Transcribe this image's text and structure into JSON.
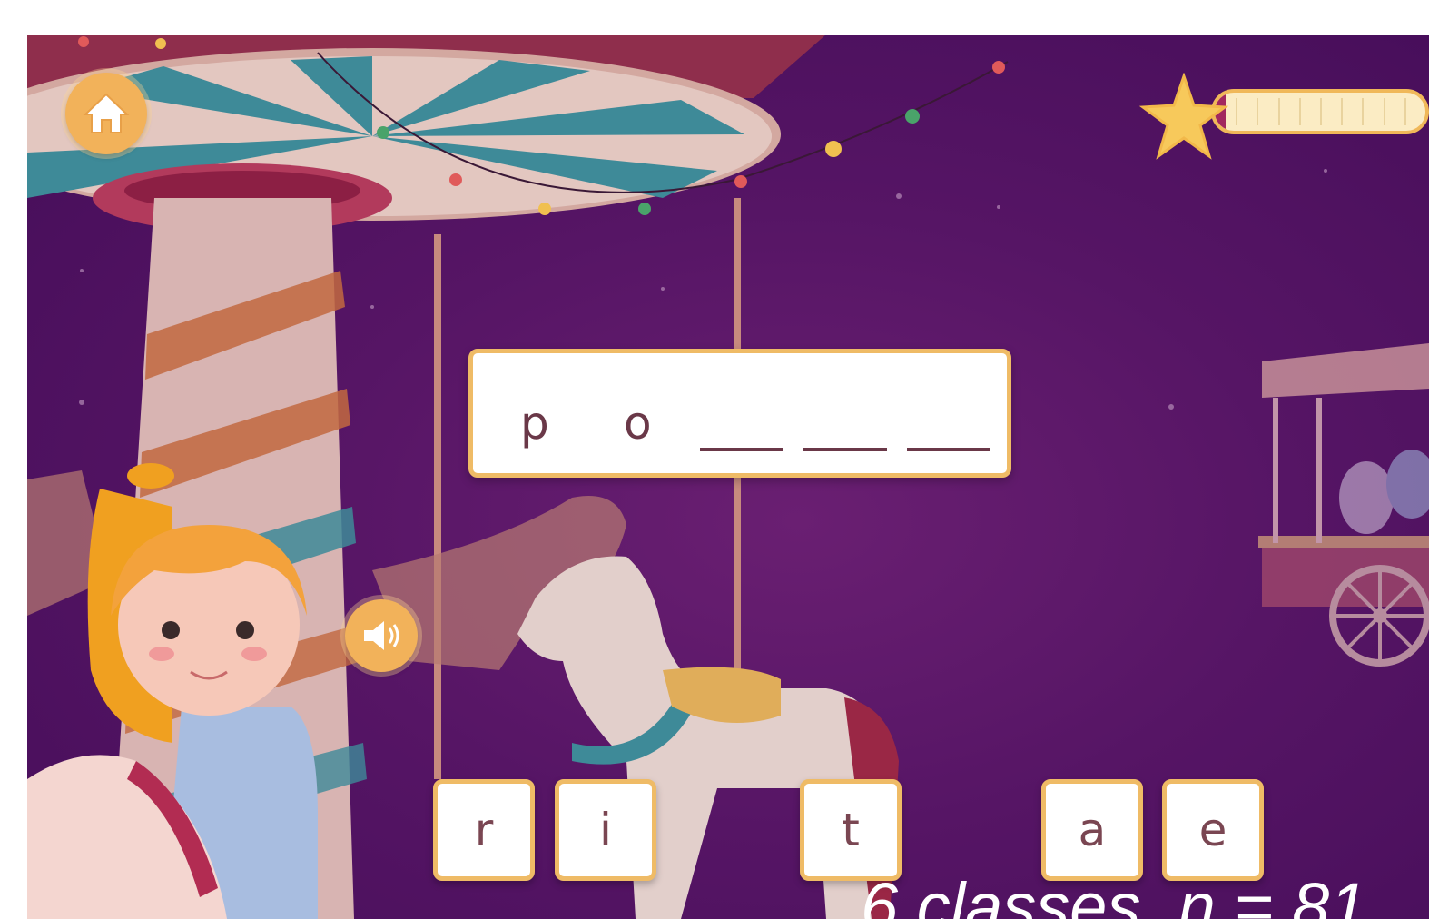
{
  "word": {
    "letters": [
      "p",
      "o"
    ],
    "blank_count": 3
  },
  "letter_tiles": [
    "r",
    "i",
    "t",
    "a",
    "e"
  ],
  "progress": {
    "filled_fraction": 0.05,
    "segments": 10
  },
  "caption": "6 classes, n = 81",
  "colors": {
    "accent": "#efbb66",
    "background": "#561565",
    "progress_fill": "#a2285e",
    "letter": "#6a3848"
  }
}
